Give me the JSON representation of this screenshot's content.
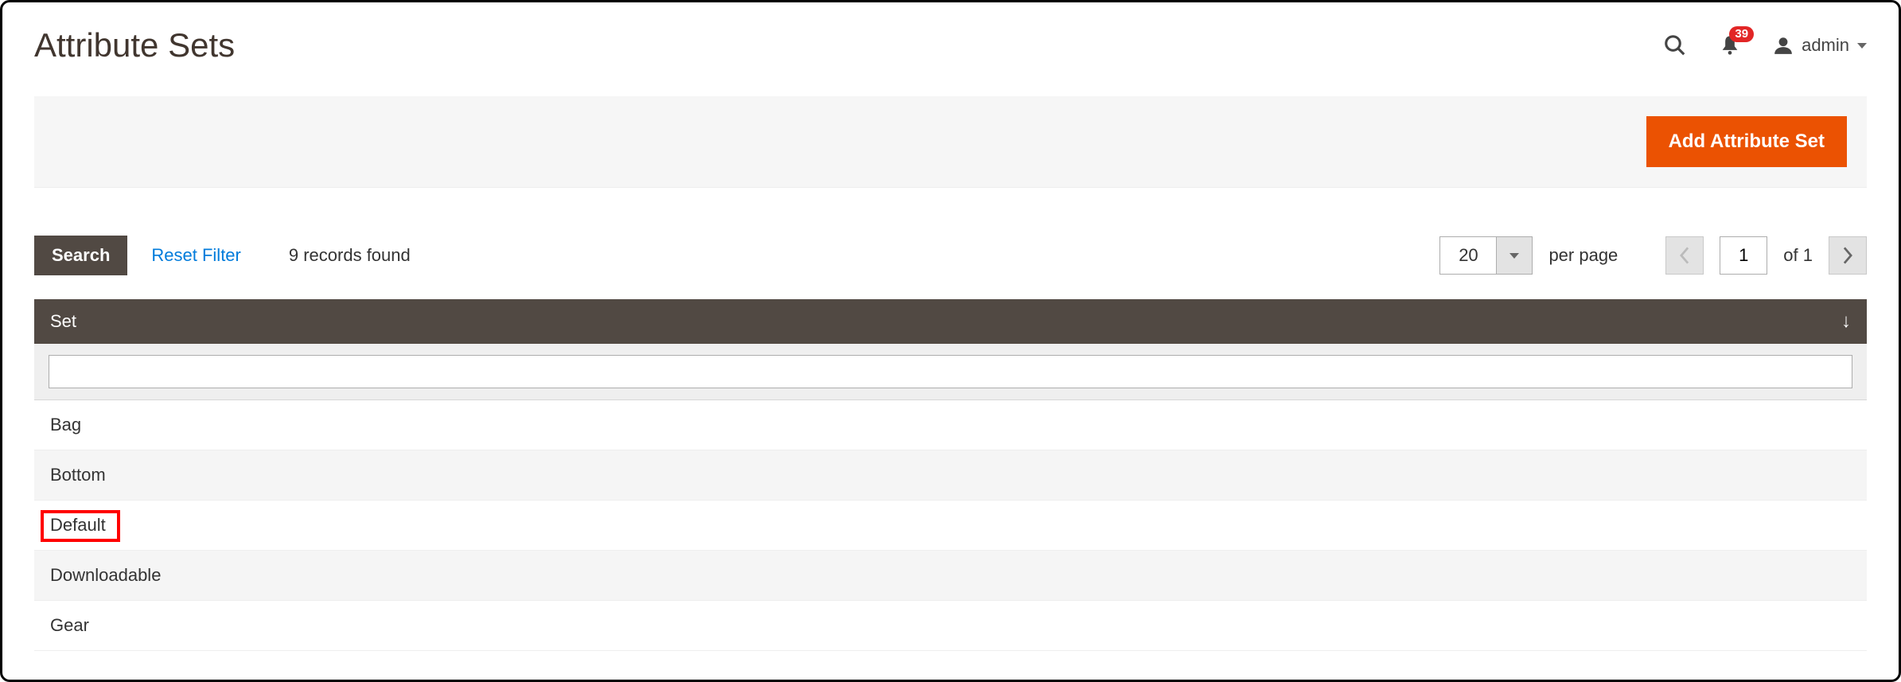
{
  "header": {
    "title": "Attribute Sets",
    "notification_count": "39",
    "user_label": "admin"
  },
  "action_bar": {
    "add_button_label": "Add Attribute Set"
  },
  "toolbar": {
    "search_label": "Search",
    "reset_filter_label": "Reset Filter",
    "records_found_label": "9 records found",
    "page_size_value": "20",
    "per_page_label": "per page",
    "page_current": "1",
    "of_label": "of 1"
  },
  "grid": {
    "column_header": "Set",
    "filter_value": "",
    "rows": [
      {
        "label": "Bag",
        "highlighted": false
      },
      {
        "label": "Bottom",
        "highlighted": false
      },
      {
        "label": "Default",
        "highlighted": true
      },
      {
        "label": "Downloadable",
        "highlighted": false
      },
      {
        "label": "Gear",
        "highlighted": false
      }
    ]
  }
}
